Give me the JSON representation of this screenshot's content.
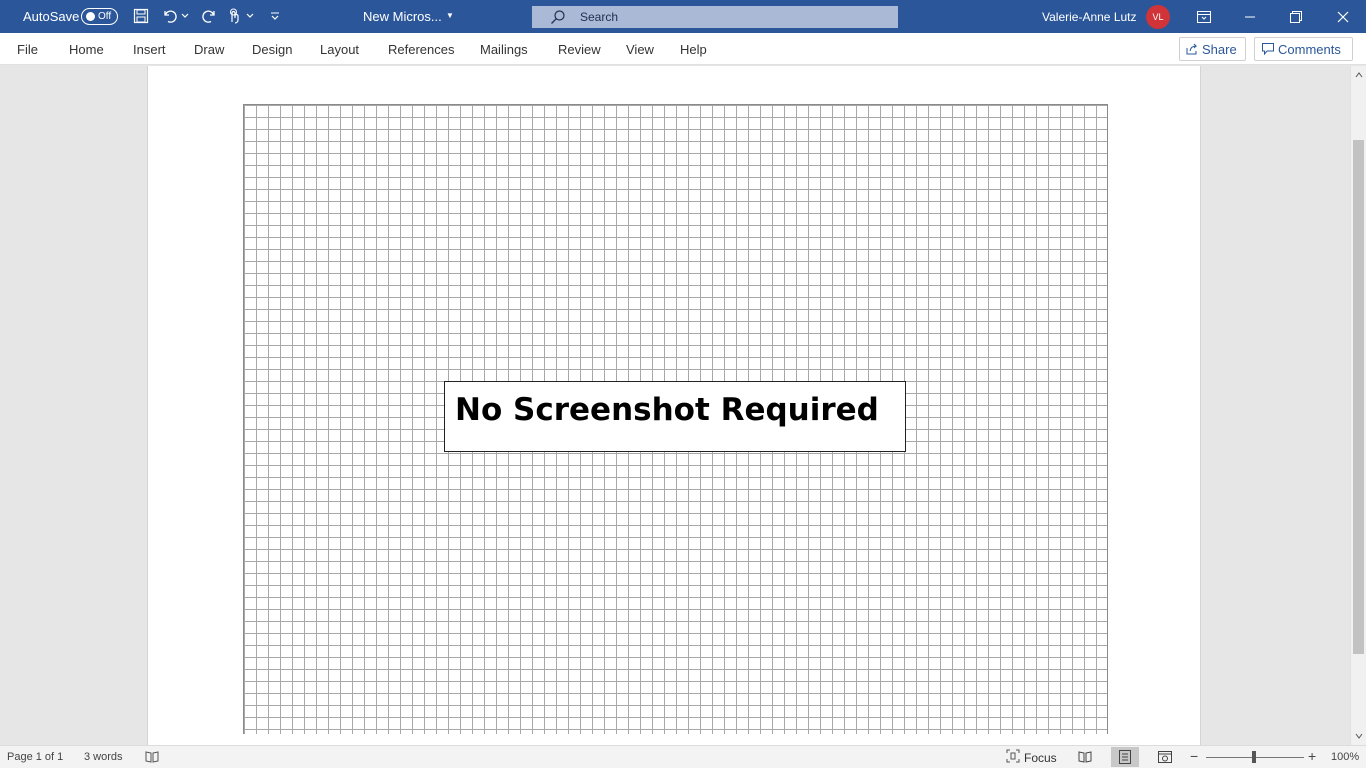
{
  "titlebar": {
    "autosave_label": "AutoSave",
    "autosave_state": "Off",
    "document_title": "New Micros...",
    "search_placeholder": "Search",
    "user_name": "Valerie-Anne Lutz",
    "user_initials": "VL",
    "accent_color": "#2b579a",
    "avatar_color": "#d13438"
  },
  "ribbon": {
    "tabs": [
      "File",
      "Home",
      "Insert",
      "Draw",
      "Design",
      "Layout",
      "References",
      "Mailings",
      "Review",
      "View",
      "Help"
    ],
    "share_label": "Share",
    "comments_label": "Comments"
  },
  "document": {
    "textbox_text": "No Screenshot Required"
  },
  "statusbar": {
    "page_info": "Page 1 of 1",
    "word_count": "3 words",
    "focus_label": "Focus",
    "zoom_level": "100%"
  }
}
